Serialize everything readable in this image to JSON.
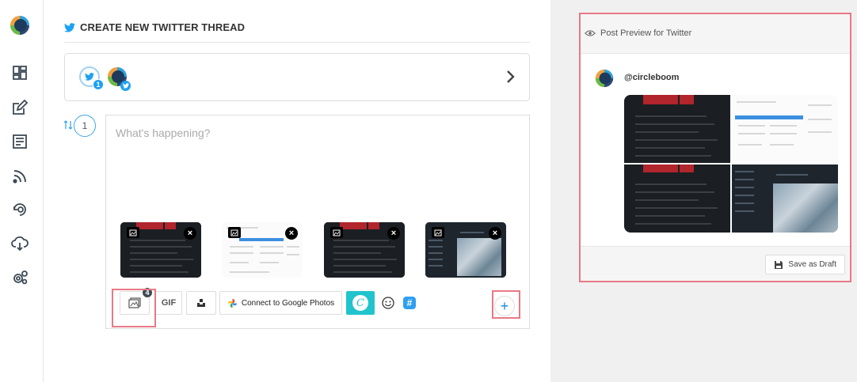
{
  "sidebar": {
    "logo": "circleboom-logo",
    "items": [
      {
        "icon": "dashboard-icon"
      },
      {
        "icon": "compose-icon"
      },
      {
        "icon": "articles-icon"
      },
      {
        "icon": "rss-icon"
      },
      {
        "icon": "refresh-post-icon"
      },
      {
        "icon": "cloud-download-icon"
      },
      {
        "icon": "settings-icon"
      }
    ]
  },
  "header": {
    "title": "CREATE NEW TWITTER THREAD",
    "icon": "twitter-icon"
  },
  "account_selector": {
    "count": "1"
  },
  "thread": {
    "step_number": "1",
    "placeholder": "What's happening?",
    "media_count": "4",
    "toolbar": {
      "gif_label": "GIF",
      "google_photos_label": "Connect to Google Photos"
    }
  },
  "preview": {
    "title": "Post Preview for Twitter",
    "handle": "@circleboom",
    "save_draft_label": "Save as Draft"
  },
  "colors": {
    "accent": "#1da1f2",
    "highlight": "#e87985",
    "canva": "#21c4cc"
  }
}
